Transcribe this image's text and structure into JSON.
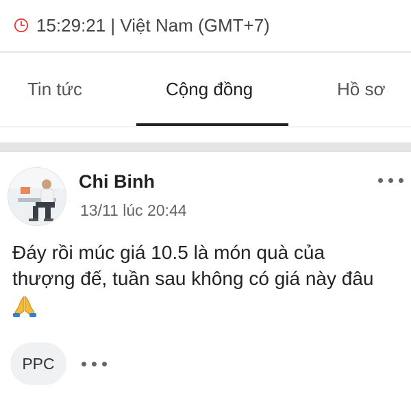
{
  "status_bar": {
    "time_text": "15:29:21 | Việt Nam (GMT+7)"
  },
  "tabs": [
    {
      "label": "Tin tức",
      "active": false
    },
    {
      "label": "Cộng đồng",
      "active": true
    },
    {
      "label": "Hồ sơ",
      "active": false
    }
  ],
  "post": {
    "author": "Chi Binh",
    "timestamp": "13/11 lúc 20:44",
    "body_lines": [
      "Đáy rồi múc giá 10.5 là món quà của",
      "thượng đế, tuần sau không có giá này đâu"
    ],
    "tag": "PPC"
  },
  "icons": {
    "clock": "clock-icon",
    "more": "more-horizontal-icon",
    "pray": "folded-hands-icon"
  },
  "colors": {
    "clock": "#e53935",
    "active_tab_underline": "#222222",
    "separator_band": "#e4e4e4"
  }
}
